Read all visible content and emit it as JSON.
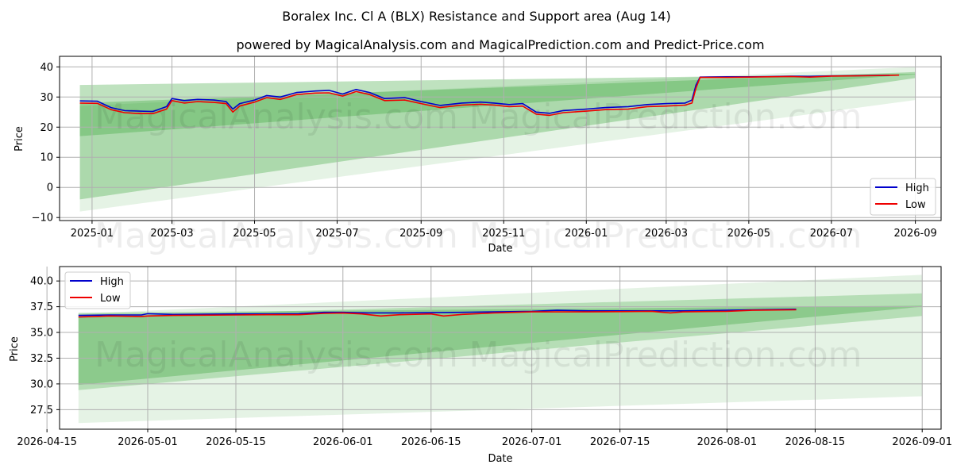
{
  "figure": {
    "title": "Boralex Inc. Cl A (BLX) Resistance and Support area (Aug 14)",
    "subtitle": "powered by MagicalAnalysis.com and MagicalPrediction.com and Predict-Price.com",
    "watermarks": [
      "MagicalAnalysis.com",
      "MagicalPrediction.com"
    ]
  },
  "colors": {
    "high": "#0000cc",
    "low": "#ee0000",
    "band": "#2ca02c",
    "grid": "#b0b0b0"
  },
  "chart_data": [
    {
      "type": "line",
      "name": "overview",
      "xlabel": "Date",
      "ylabel": "Price",
      "xlim": [
        "2024-12-08",
        "2026-09-20"
      ],
      "ylim": [
        -11,
        43.5
      ],
      "xticks": [
        "2025-01",
        "2025-03",
        "2025-05",
        "2025-07",
        "2025-09",
        "2025-11",
        "2026-01",
        "2026-03",
        "2026-05",
        "2026-07",
        "2026-09"
      ],
      "xtick_dates": [
        "2025-01-01",
        "2025-03-01",
        "2025-05-01",
        "2025-07-01",
        "2025-09-01",
        "2025-11-01",
        "2026-01-01",
        "2026-03-01",
        "2026-05-01",
        "2026-07-01",
        "2026-09-01"
      ],
      "yticks": [
        -10,
        0,
        10,
        20,
        30,
        40
      ],
      "legend": {
        "placement": "lower-right",
        "entries": [
          "High",
          "Low"
        ]
      },
      "grid": true,
      "bands": [
        {
          "x": [
            "2024-12-23",
            "2026-09-01"
          ],
          "upper": [
            34.0,
            37.7
          ],
          "lower": [
            17.0,
            37.5
          ],
          "opacity": 0.3
        },
        {
          "x": [
            "2024-12-23",
            "2026-09-01"
          ],
          "upper": [
            28.0,
            38.3
          ],
          "lower": [
            -4.0,
            36.3
          ],
          "opacity": 0.3
        },
        {
          "x": [
            "2024-12-23",
            "2026-09-01"
          ],
          "upper": [
            27.0,
            40.0
          ],
          "lower": [
            -8.0,
            29.0
          ],
          "opacity": 0.12
        }
      ],
      "series": [
        {
          "name": "High",
          "x": [
            "2024-12-23",
            "2025-01-05",
            "2025-01-15",
            "2025-01-25",
            "2025-02-05",
            "2025-02-15",
            "2025-02-25",
            "2025-03-01",
            "2025-03-10",
            "2025-03-20",
            "2025-04-01",
            "2025-04-10",
            "2025-04-15",
            "2025-04-20",
            "2025-05-01",
            "2025-05-10",
            "2025-05-20",
            "2025-06-01",
            "2025-06-15",
            "2025-06-25",
            "2025-07-05",
            "2025-07-15",
            "2025-07-25",
            "2025-08-05",
            "2025-08-20",
            "2025-09-01",
            "2025-09-15",
            "2025-10-01",
            "2025-10-15",
            "2025-10-25",
            "2025-11-05",
            "2025-11-15",
            "2025-11-25",
            "2025-12-05",
            "2025-12-15",
            "2026-01-01",
            "2026-01-15",
            "2026-02-01",
            "2026-02-15",
            "2026-03-01",
            "2026-03-15",
            "2026-03-20",
            "2026-03-23",
            "2026-03-26",
            "2026-04-15",
            "2026-05-01",
            "2026-05-15",
            "2026-06-01",
            "2026-06-15",
            "2026-07-01",
            "2026-07-15",
            "2026-08-01",
            "2026-08-13"
          ],
          "y": [
            28.7,
            28.6,
            26.5,
            25.5,
            25.3,
            25.2,
            26.8,
            29.5,
            28.8,
            29.2,
            29.0,
            28.5,
            26.0,
            27.8,
            29.0,
            30.5,
            30.0,
            31.5,
            32.0,
            32.2,
            31.0,
            32.5,
            31.5,
            29.5,
            29.8,
            28.5,
            27.2,
            28.0,
            28.3,
            28.0,
            27.5,
            27.8,
            25.0,
            24.6,
            25.5,
            26.0,
            26.5,
            26.8,
            27.5,
            27.8,
            28.0,
            29.0,
            34.0,
            36.6,
            36.7,
            36.7,
            36.75,
            36.9,
            36.85,
            37.0,
            37.05,
            37.15,
            37.2
          ]
        },
        {
          "name": "Low",
          "x": [
            "2024-12-23",
            "2025-01-05",
            "2025-01-15",
            "2025-01-25",
            "2025-02-05",
            "2025-02-15",
            "2025-02-25",
            "2025-03-01",
            "2025-03-10",
            "2025-03-20",
            "2025-04-01",
            "2025-04-10",
            "2025-04-15",
            "2025-04-20",
            "2025-05-01",
            "2025-05-10",
            "2025-05-20",
            "2025-06-01",
            "2025-06-15",
            "2025-06-25",
            "2025-07-05",
            "2025-07-15",
            "2025-07-25",
            "2025-08-05",
            "2025-08-20",
            "2025-09-01",
            "2025-09-15",
            "2025-10-01",
            "2025-10-15",
            "2025-10-25",
            "2025-11-05",
            "2025-11-15",
            "2025-11-25",
            "2025-12-05",
            "2025-12-15",
            "2026-01-01",
            "2026-01-15",
            "2026-02-01",
            "2026-02-15",
            "2026-03-01",
            "2026-03-15",
            "2026-03-20",
            "2026-03-23",
            "2026-03-26",
            "2026-04-15",
            "2026-05-01",
            "2026-05-15",
            "2026-06-01",
            "2026-06-15",
            "2026-07-01",
            "2026-07-15",
            "2026-08-01",
            "2026-08-13",
            "2026-08-20"
          ],
          "y": [
            28.0,
            27.9,
            25.8,
            24.8,
            24.5,
            24.5,
            26.0,
            28.8,
            28.0,
            28.5,
            28.2,
            27.8,
            25.0,
            27.0,
            28.3,
            29.8,
            29.2,
            30.8,
            31.3,
            31.4,
            30.3,
            31.8,
            30.8,
            28.8,
            29.0,
            27.8,
            26.5,
            27.3,
            27.6,
            27.3,
            26.8,
            27.0,
            24.3,
            23.9,
            24.8,
            25.3,
            25.8,
            26.0,
            26.8,
            27.0,
            27.3,
            28.0,
            33.0,
            36.5,
            36.5,
            36.6,
            36.7,
            36.8,
            36.6,
            36.95,
            37.0,
            37.1,
            37.2,
            37.25
          ]
        }
      ]
    },
    {
      "type": "line",
      "name": "zoom",
      "xlabel": "Date",
      "ylabel": "Price",
      "xlim": [
        "2026-04-17",
        "2026-09-04"
      ],
      "ylim": [
        25.6,
        41.4
      ],
      "xticks": [
        "2026-04-15",
        "2026-05-01",
        "2026-05-15",
        "2026-06-01",
        "2026-06-15",
        "2026-07-01",
        "2026-07-15",
        "2026-08-01",
        "2026-08-15",
        "2026-09-01"
      ],
      "yticks": [
        27.5,
        30.0,
        32.5,
        35.0,
        37.5,
        40.0
      ],
      "ytick_labels": [
        "27.5",
        "30.0",
        "32.5",
        "35.0",
        "37.5",
        "40.0"
      ],
      "legend": {
        "placement": "upper-left",
        "entries": [
          "High",
          "Low"
        ]
      },
      "grid": true,
      "bands": [
        {
          "x": [
            "2026-04-20",
            "2026-09-01"
          ],
          "upper": [
            36.9,
            37.6
          ],
          "lower": [
            29.9,
            37.5
          ],
          "opacity": 0.3
        },
        {
          "x": [
            "2026-04-20",
            "2026-09-01"
          ],
          "upper": [
            36.5,
            38.8
          ],
          "lower": [
            29.4,
            36.6
          ],
          "opacity": 0.25
        },
        {
          "x": [
            "2026-04-20",
            "2026-09-01"
          ],
          "upper": [
            36.8,
            40.6
          ],
          "lower": [
            26.2,
            28.8
          ],
          "opacity": 0.12
        }
      ],
      "series": [
        {
          "name": "High",
          "x": [
            "2026-04-20",
            "2026-04-25",
            "2026-04-30",
            "2026-05-01",
            "2026-05-05",
            "2026-05-15",
            "2026-05-20",
            "2026-05-25",
            "2026-05-29",
            "2026-06-01",
            "2026-06-05",
            "2026-06-10",
            "2026-06-15",
            "2026-06-20",
            "2026-06-25",
            "2026-07-01",
            "2026-07-05",
            "2026-07-10",
            "2026-07-15",
            "2026-07-20",
            "2026-07-25",
            "2026-08-01",
            "2026-08-05",
            "2026-08-12"
          ],
          "y": [
            36.65,
            36.7,
            36.7,
            36.82,
            36.75,
            36.8,
            36.8,
            36.82,
            36.95,
            36.95,
            36.9,
            36.9,
            36.92,
            36.95,
            37.0,
            37.05,
            37.15,
            37.1,
            37.1,
            37.1,
            37.1,
            37.15,
            37.2,
            37.25
          ]
        },
        {
          "name": "Low",
          "x": [
            "2026-04-20",
            "2026-04-25",
            "2026-04-30",
            "2026-05-01",
            "2026-05-05",
            "2026-05-15",
            "2026-05-20",
            "2026-05-25",
            "2026-05-29",
            "2026-06-01",
            "2026-06-04",
            "2026-06-07",
            "2026-06-10",
            "2026-06-15",
            "2026-06-17",
            "2026-06-20",
            "2026-06-25",
            "2026-07-01",
            "2026-07-05",
            "2026-07-10",
            "2026-07-15",
            "2026-07-20",
            "2026-07-23",
            "2026-07-25",
            "2026-08-01",
            "2026-08-05",
            "2026-08-12"
          ],
          "y": [
            36.5,
            36.6,
            36.55,
            36.6,
            36.65,
            36.7,
            36.72,
            36.72,
            36.85,
            36.88,
            36.8,
            36.6,
            36.72,
            36.8,
            36.6,
            36.75,
            36.9,
            37.0,
            37.0,
            37.0,
            37.02,
            37.05,
            36.9,
            37.0,
            37.05,
            37.15,
            37.2
          ]
        }
      ]
    }
  ]
}
